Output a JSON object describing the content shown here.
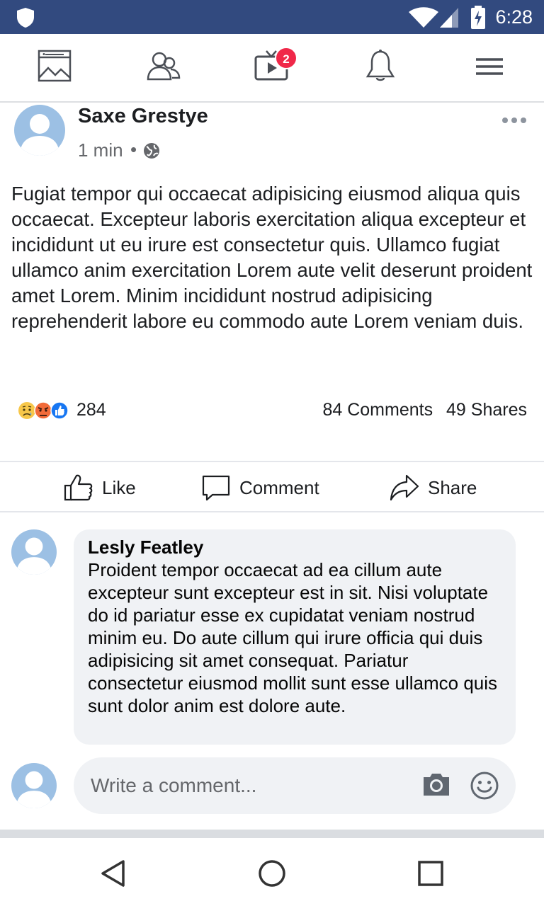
{
  "status_bar": {
    "time": "6:28",
    "background": "#324a7f"
  },
  "top_nav": {
    "icons": [
      "news-feed-icon",
      "friends-icon",
      "watch-icon",
      "notifications-bell-icon",
      "menu-icon"
    ],
    "watch_badge": "2"
  },
  "post": {
    "author": "Saxe Grestye",
    "time": "1 min",
    "separator": "•",
    "privacy_icon": "globe-icon",
    "body": "Fugiat tempor qui occaecat adipisicing eiusmod aliqua quis occaecat. Excepteur laboris exercitation aliqua excepteur et incididunt ut eu irure est consectetur quis. Ullamco fugiat ullamco anim exercitation Lorem aute velit deserunt proident amet Lorem. Minim incididunt nostrud adipisicing reprehenderit labore eu commodo aute Lorem veniam duis.",
    "reactions": [
      "sad-reaction-icon",
      "angry-reaction-icon",
      "like-reaction-icon"
    ],
    "reaction_count": "284",
    "comments_count": "84 Comments",
    "shares_count": "49 Shares"
  },
  "actions": {
    "like": "Like",
    "comment": "Comment",
    "share": "Share"
  },
  "comment": {
    "name": "Lesly Featley",
    "text": "Proident tempor occaecat ad ea cillum aute excepteur sunt excepteur est in sit. Nisi voluptate do id pariatur esse ex cupidatat veniam nostrud minim eu. Do aute cillum qui irure officia qui duis adipisicing sit amet consequat. Pariatur consectetur eiusmod mollit sunt esse ullamco quis sunt dolor anim est dolore aute."
  },
  "composer": {
    "placeholder": "Write a comment..."
  },
  "colors": {
    "brand": "#324a7f",
    "badge": "#f02849",
    "avatar": "#9cc0e4",
    "bubble": "#f0f2f5"
  }
}
